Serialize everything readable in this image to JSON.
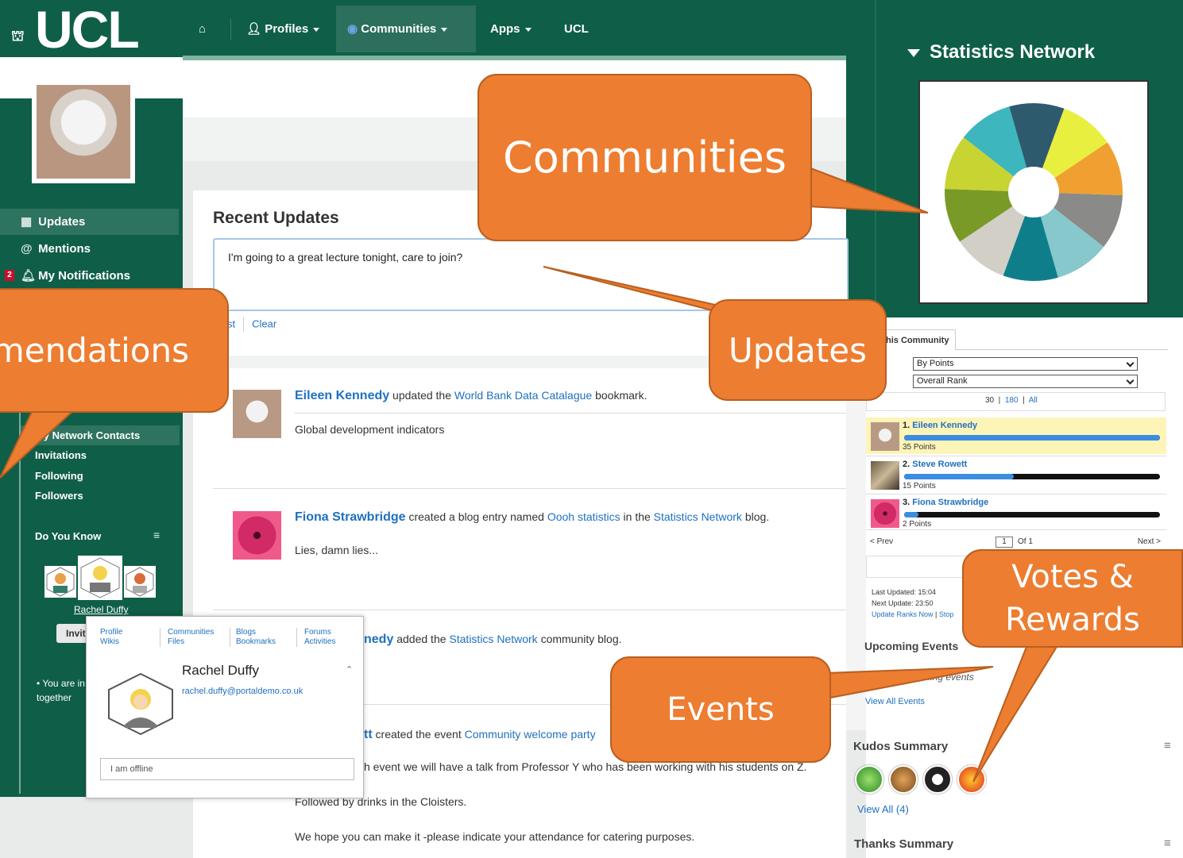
{
  "topnav": {
    "logo": "UCL",
    "items": [
      {
        "label": "Profiles"
      },
      {
        "label": "Communities"
      },
      {
        "label": "Apps"
      },
      {
        "label": "UCL"
      }
    ]
  },
  "sidebar": {
    "items": [
      {
        "label": "Updates"
      },
      {
        "label": "Mentions"
      },
      {
        "label": "My Notifications",
        "badge": "2"
      }
    ],
    "network_links": [
      "My Network Contacts",
      "Invitations",
      "Following",
      "Followers"
    ],
    "do_you_know": {
      "title": "Do You Know",
      "person": "Rachel Duffy",
      "invite": "Invit"
    },
    "bullet": "You are in together"
  },
  "updates": {
    "title": "Recent Updates",
    "status_text": "I'm going to a great lecture tonight, care to join?",
    "post_label": "st",
    "clear_label": "Clear",
    "entries": [
      {
        "actor": "Eileen Kennedy",
        "verb": "updated the",
        "object": "World Bank Data Catalague",
        "tail": "bookmark.",
        "body": "Global development indicators"
      },
      {
        "actor": "Fiona Strawbridge",
        "verb": "created a blog entry named",
        "object": "Oooh statistics",
        "mid": "in the",
        "object2": "Statistics Network",
        "tail": "blog.",
        "body": "Lies, damn lies..."
      },
      {
        "actor": "nedy",
        "verb": "added the",
        "object": "Statistics Network",
        "tail": "community blog."
      },
      {
        "actor": "tt",
        "verb": "created the event",
        "object": "Community welcome party",
        "body": "h event we will have a talk from Professor Y who has been working with his students on Z.",
        "body2": "Followed by drinks in the Cloisters.",
        "body3": "We hope you can make it -please indicate your attendance for catering purposes."
      }
    ]
  },
  "bizcard": {
    "links": [
      [
        "Profile",
        "Wikis"
      ],
      [
        "Communities",
        "Files"
      ],
      [
        "Blogs",
        "Bookmarks"
      ],
      [
        "Forums",
        "Activities"
      ]
    ],
    "name": "Rachel Duffy",
    "email": "rachel.duffy@portaldemo.co.uk",
    "status_placeholder": "I am offline"
  },
  "community": {
    "title": "Statistics Network",
    "ranking": {
      "tab": "his Community",
      "sort_by": "By Points",
      "rank_type": "Overall Rank",
      "ranges": [
        "30",
        "180",
        "All"
      ],
      "entries": [
        {
          "rank": "1.",
          "name": "Eileen Kennedy",
          "points_label": "35 Points",
          "points": 35,
          "max": 35
        },
        {
          "rank": "2.",
          "name": "Steve Rowett",
          "points_label": "15 Points",
          "points": 15,
          "max": 35
        },
        {
          "rank": "3.",
          "name": "Fiona Strawbridge",
          "points_label": "2 Points",
          "points": 2,
          "max": 35
        }
      ],
      "prev": "< Prev",
      "page": "1",
      "of": "Of 1",
      "next": "Next >",
      "last_updated": "Last Updated: 15:04",
      "next_update": "Next Update: 23:50",
      "update_now": "Update Ranks Now",
      "stop": "Stop"
    },
    "events": {
      "title": "Upcoming Events",
      "none": "upcoming events",
      "view_all": "View All Events"
    },
    "kudos": {
      "title": "Kudos Summary",
      "view_all": "View All (4)"
    },
    "thanks": {
      "title": "Thanks Summary"
    }
  },
  "colors": {
    "brand_green": "#0f5e48",
    "callout_orange": "#ed7d31",
    "link_blue": "#1f70c1",
    "pie": [
      "#e8ef3f",
      "#f0a030",
      "#8a8a88",
      "#86c8cc",
      "#0e7f8a",
      "#d2cfc6",
      "#7a9a28",
      "#c8d432",
      "#3eb6bd",
      "#2e5a6e"
    ]
  },
  "callouts": {
    "communities": "Communities",
    "updates": "Updates",
    "recommendations": "mendations",
    "events": "Events",
    "votes": "Votes & Rewards"
  }
}
